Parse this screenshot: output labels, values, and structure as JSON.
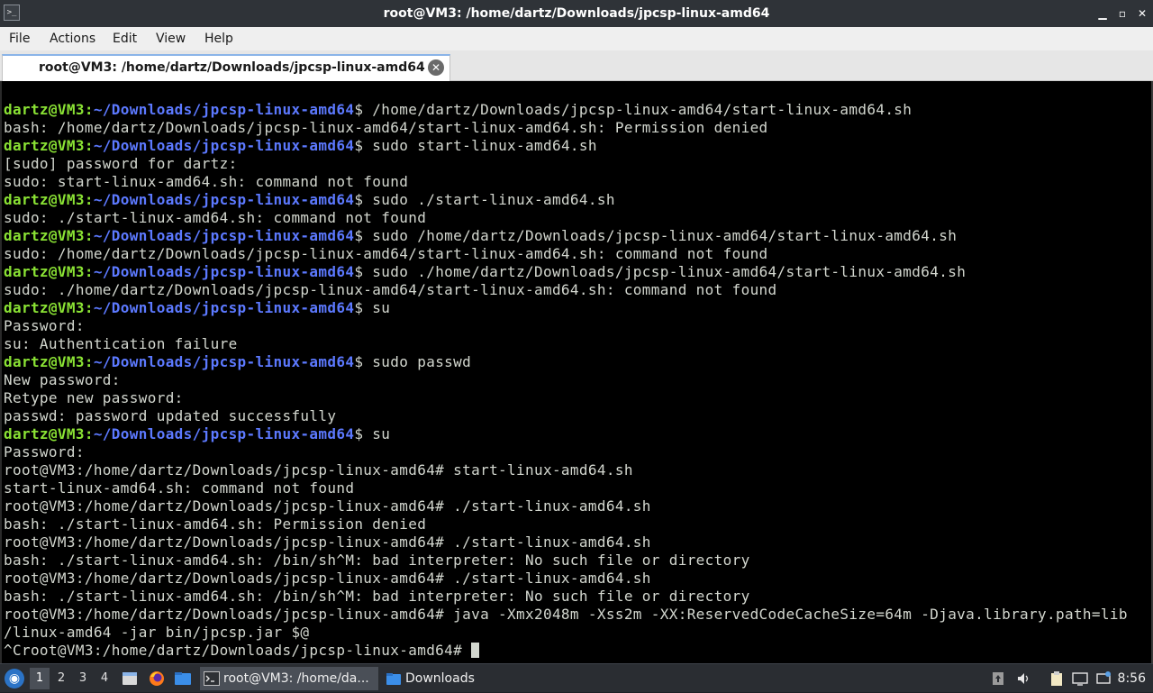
{
  "window": {
    "title": "root@VM3: /home/dartz/Downloads/jpcsp-linux-amd64",
    "app_icon_glyph": ">_"
  },
  "window_controls": {
    "minimize": "▁",
    "maximize": "▫",
    "close": "✕"
  },
  "menu": [
    "File",
    "Actions",
    "Edit",
    "View",
    "Help"
  ],
  "tab": {
    "label": "root@VM3: /home/dartz/Downloads/jpcsp-linux-amd64",
    "close_glyph": "✕"
  },
  "terminal": {
    "prompt_user": "dartz@VM3:",
    "prompt_path": "~/Downloads/jpcsp-linux-amd64",
    "lines": [
      {
        "kind": "prompt",
        "text": "$ /home/dartz/Downloads/jpcsp-linux-amd64/start-linux-amd64.sh"
      },
      {
        "kind": "out",
        "text": "bash: /home/dartz/Downloads/jpcsp-linux-amd64/start-linux-amd64.sh: Permission denied"
      },
      {
        "kind": "prompt",
        "text": "$ sudo start-linux-amd64.sh"
      },
      {
        "kind": "out",
        "text": "[sudo] password for dartz:"
      },
      {
        "kind": "out",
        "text": "sudo: start-linux-amd64.sh: command not found"
      },
      {
        "kind": "prompt",
        "text": "$ sudo ./start-linux-amd64.sh"
      },
      {
        "kind": "out",
        "text": "sudo: ./start-linux-amd64.sh: command not found"
      },
      {
        "kind": "prompt",
        "text": "$ sudo /home/dartz/Downloads/jpcsp-linux-amd64/start-linux-amd64.sh"
      },
      {
        "kind": "out",
        "text": "sudo: /home/dartz/Downloads/jpcsp-linux-amd64/start-linux-amd64.sh: command not found"
      },
      {
        "kind": "prompt",
        "text": "$ sudo ./home/dartz/Downloads/jpcsp-linux-amd64/start-linux-amd64.sh"
      },
      {
        "kind": "out",
        "text": "sudo: ./home/dartz/Downloads/jpcsp-linux-amd64/start-linux-amd64.sh: command not found"
      },
      {
        "kind": "prompt",
        "text": "$ su"
      },
      {
        "kind": "out",
        "text": "Password:"
      },
      {
        "kind": "out",
        "text": "su: Authentication failure"
      },
      {
        "kind": "prompt",
        "text": "$ sudo passwd"
      },
      {
        "kind": "out",
        "text": "New password:"
      },
      {
        "kind": "out",
        "text": "Retype new password:"
      },
      {
        "kind": "out",
        "text": "passwd: password updated successfully"
      },
      {
        "kind": "prompt",
        "text": "$ su"
      },
      {
        "kind": "out",
        "text": "Password:"
      },
      {
        "kind": "out",
        "text": "root@VM3:/home/dartz/Downloads/jpcsp-linux-amd64# start-linux-amd64.sh"
      },
      {
        "kind": "out",
        "text": "start-linux-amd64.sh: command not found"
      },
      {
        "kind": "out",
        "text": "root@VM3:/home/dartz/Downloads/jpcsp-linux-amd64# ./start-linux-amd64.sh"
      },
      {
        "kind": "out",
        "text": "bash: ./start-linux-amd64.sh: Permission denied"
      },
      {
        "kind": "out",
        "text": "root@VM3:/home/dartz/Downloads/jpcsp-linux-amd64# ./start-linux-amd64.sh"
      },
      {
        "kind": "out",
        "text": "bash: ./start-linux-amd64.sh: /bin/sh^M: bad interpreter: No such file or directory"
      },
      {
        "kind": "out",
        "text": "root@VM3:/home/dartz/Downloads/jpcsp-linux-amd64# ./start-linux-amd64.sh"
      },
      {
        "kind": "out",
        "text": "bash: ./start-linux-amd64.sh: /bin/sh^M: bad interpreter: No such file or directory"
      },
      {
        "kind": "out",
        "text": "root@VM3:/home/dartz/Downloads/jpcsp-linux-amd64# java -Xmx2048m -Xss2m -XX:ReservedCodeCacheSize=64m -Djava.library.path=lib"
      },
      {
        "kind": "out",
        "text": "/linux-amd64 -jar bin/jpcsp.jar $@"
      },
      {
        "kind": "cursor",
        "text": "^Croot@VM3:/home/dartz/Downloads/jpcsp-linux-amd64# "
      }
    ]
  },
  "taskbar": {
    "workspaces": [
      "1",
      "2",
      "3",
      "4"
    ],
    "active_workspace": "1",
    "tasks": [
      {
        "label": "root@VM3: /home/da...",
        "icon": "terminal-icon"
      },
      {
        "label": "Downloads",
        "icon": "folder-icon"
      }
    ],
    "clock": "8:56"
  }
}
